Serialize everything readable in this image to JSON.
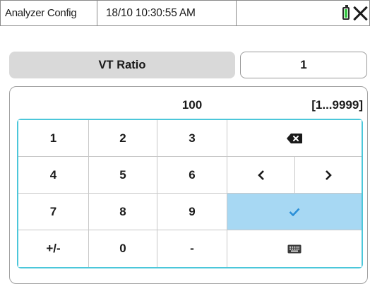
{
  "statusbar": {
    "app_title": "Analyzer Config",
    "datetime": "18/10 10:30:55 AM",
    "battery_icon": "battery-icon",
    "close_icon": "close-icon"
  },
  "parameter": {
    "label": "VT Ratio",
    "value": "1"
  },
  "keypad": {
    "entry_value": "100",
    "range": "[1...9999]",
    "keys": {
      "k1": "1",
      "k2": "2",
      "k3": "3",
      "k4": "4",
      "k5": "5",
      "k6": "6",
      "k7": "7",
      "k8": "8",
      "k9": "9",
      "sign": "+/-",
      "k0": "0",
      "minus": "-"
    },
    "icons": {
      "backspace": "backspace-icon",
      "left": "chevron-left-icon",
      "right": "chevron-right-icon",
      "confirm": "check-icon",
      "keyboard": "keyboard-icon"
    }
  },
  "colors": {
    "battery_fill": "#36c544",
    "grid_border": "#4cc7da",
    "confirm_bg": "#a7d8f3",
    "confirm_check": "#2a8fd8",
    "label_bg": "#d9d9d9"
  }
}
